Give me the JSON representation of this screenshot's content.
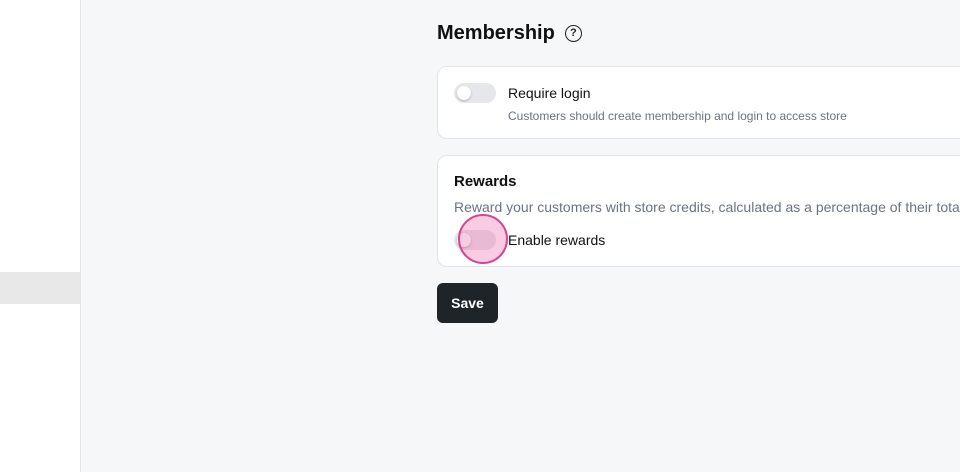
{
  "section": {
    "title": "Membership",
    "help_icon": "?"
  },
  "membership": {
    "require_login": {
      "label": "Require login",
      "hint": "Customers should create membership and login to access store",
      "enabled": false
    }
  },
  "rewards": {
    "title": "Rewards",
    "description": "Reward your customers with store credits, calculated as a percentage of their total",
    "toggle_label": "Enable rewards",
    "enabled": false
  },
  "actions": {
    "save_label": "Save"
  },
  "colors": {
    "toggle_off": "#e6e7ea",
    "click_indicator": "#d9418f",
    "save_button": "#1f2428"
  }
}
